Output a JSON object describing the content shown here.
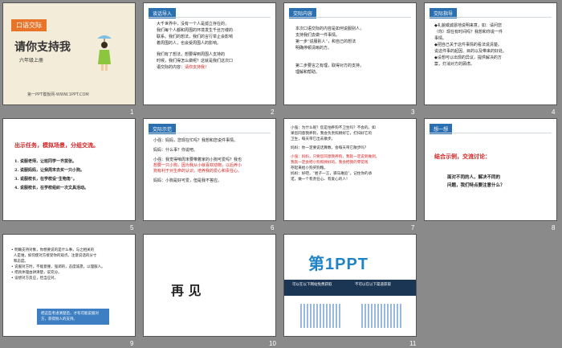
{
  "slides": [
    {
      "num": "1",
      "tag": "口语交际",
      "title": "请你支持我",
      "grade": "六年级上册",
      "footer": "第一PPT模板网-WWW.1PPT.COM"
    },
    {
      "num": "2",
      "tag": "谈话导入",
      "lines": [
        "大千世界中，没有一个人是孤立存在的，",
        "我们每个人都和周围的环境发生千丝万缕的",
        "联系。我们的想法，我们的言行举止会影响",
        "着周围的人，也会受周围人的影响。",
        "",
        "我们有了想法，想要得到周围人支持的",
        "时候，我们得怎么做呢？这就是我们这次口"
      ],
      "last": "语交际的内容：",
      "highlight": "请你支持我！"
    },
    {
      "num": "3",
      "tag": "交际内容",
      "lines": [
        "本次口语交际的内容是如何说服别人，",
        "支持我们去做一件事情。",
        "第一步“说服别人”，和自己的想法",
        "明确停顿清晰的方。",
        "",
        "第二步要言之有理，取得对方的支持，",
        "理解和帮助。"
      ]
    },
    {
      "num": "4",
      "tag": "交际指导",
      "lines": [
        "◆礼貌或诚恳地说明来意，如：请问您",
        "（你）现在有时间吗？我想和你说一件",
        "事情。",
        "◆把自己关于这件事情的看法说清楚。",
        "说这件事的起因、目的以及带来的好处。",
        "◆设想可以出现的异议，提供解决的方",
        "案，打消对方的顾虑。"
      ]
    },
    {
      "num": "5",
      "heading": "出示任务，模拟场景，分组交流。",
      "items": [
        "1. 说服老师，让班同学一齐拔张。",
        "2. 说服妈妈，让我周末去买一只小狗。",
        "3. 说服校长，在学校设“生物角”。",
        "4. 说服校长，在学校组织一次文具活动。"
      ]
    },
    {
      "num": "6",
      "tag": "交际示范",
      "lines": [
        "小强：妈妈，您现在忙吗？我想和您说件事情。",
        "",
        "妈妈：什么事？你说吧。",
        "",
        "小强：我觉得咱周末要带着家的小狗可爱吗？我也",
        "想要一只小狗，因为我从小就喜欢动物，以后养小",
        "狗有利于对生命的认识，培养我的爱心和责任心。",
        "",
        "妈妈：小狗是好可爱，但是我不答应。"
      ]
    },
    {
      "num": "7",
      "lines": [
        "小强：为什么呢？您是怕养狗不卫生吗？不会的。如",
        "果您同意我养狗，我会负责照顾好它，打扫好它的",
        "卫生，每天带它出去散步。",
        "",
        "妈妈：你一定要说话算数，会每天带它散步吗？",
        "",
        "小强：妈妈，只要您同意我养狗，我就一定说到做到。",
        "我就一定会把小狗照顾好的。我会把我的零花钱",
        "存起来给小狗买狗粮。",
        "妈妈：好吧，“君子一言，驷马难追”。记住你的承",
        "诺，做一个有责任心、有爱心的人！"
      ]
    },
    {
      "num": "8",
      "tag": "想一想",
      "heading": "结合示例，交流讨论：",
      "lines": [
        "面对不同的人，解决不同的",
        "问题，我们特点要注意什么？"
      ]
    },
    {
      "num": "9",
      "items": [
        "明确支持对象，你想要说的是什么事，与之相关的",
        "人是谁，如何使对方接受你的观点。注意说话的分寸",
        "和态度。",
        "说服对方时，不能意撞，强调的，态度诚恳，以理服人。",
        "把具体理由讲清楚，说充分。",
        "设想对方反应，恰当应对。"
      ],
      "box": "把这些考虑清楚后，才有可能说服对方，获得别人的支持。"
    },
    {
      "num": "10",
      "text": "再 见"
    },
    {
      "num": "11",
      "logo": "第1PPT",
      "left_title": "可以在以下网站免费获取",
      "right_title": "不可以在以下渠道获取"
    }
  ]
}
